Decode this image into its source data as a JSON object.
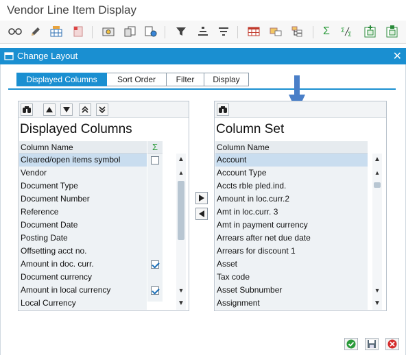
{
  "window": {
    "title": "Vendor Line Item Display"
  },
  "toolbar": {
    "icons": [
      "glasses-icon",
      "pencil-icon",
      "grid-settings-icon",
      "document-icon",
      "money-icon",
      "copy-document-icon",
      "document-globe-icon",
      "filter-icon",
      "align-center-icon",
      "sort-icon",
      "table-icon",
      "layout-select-icon",
      "layout-tree-icon",
      "sum-icon",
      "subtotal-icon",
      "add-column-icon",
      "save-layout-icon"
    ]
  },
  "dialog": {
    "title": "Change Layout",
    "close_label": "✕",
    "tabs": [
      {
        "label": "Displayed Columns",
        "active": true
      },
      {
        "label": "Sort Order",
        "active": false
      },
      {
        "label": "Filter",
        "active": false
      },
      {
        "label": "Display",
        "active": false
      }
    ]
  },
  "left_panel": {
    "heading": "Displayed Columns",
    "column_header": "Column Name",
    "sum_header": "Σ",
    "rows": [
      {
        "label": "Cleared/open items symbol",
        "checked": false,
        "selected": true
      },
      {
        "label": "Vendor",
        "checked": false
      },
      {
        "label": "Document Type",
        "checked": false
      },
      {
        "label": "Document Number",
        "checked": false
      },
      {
        "label": "Reference",
        "checked": false
      },
      {
        "label": "Document Date",
        "checked": false
      },
      {
        "label": "Posting Date",
        "checked": false
      },
      {
        "label": "Offsetting acct no.",
        "checked": false
      },
      {
        "label": "Amount in doc. curr.",
        "checked": true
      },
      {
        "label": "Document currency",
        "checked": false
      },
      {
        "label": "Amount in local currency",
        "checked": true
      },
      {
        "label": "Local Currency",
        "checked": false
      }
    ]
  },
  "right_panel": {
    "heading": "Column Set",
    "column_header": "Column Name",
    "rows": [
      {
        "label": "Account",
        "selected": true
      },
      {
        "label": "Account Type"
      },
      {
        "label": "Accts rble pled.ind."
      },
      {
        "label": "Amount in loc.curr.2"
      },
      {
        "label": "Amt in loc.curr. 3"
      },
      {
        "label": "Amt in payment currency"
      },
      {
        "label": "Arrears after net due date"
      },
      {
        "label": "Arrears for discount 1"
      },
      {
        "label": "Asset"
      },
      {
        "label": "Tax code"
      },
      {
        "label": "Asset Subnumber"
      },
      {
        "label": "Assignment"
      }
    ]
  },
  "colors": {
    "accent": "#1a8fd1",
    "selection": "#c9ddef",
    "check": "#1a6fb8",
    "annotation_arrow": "#4a7fc8"
  }
}
